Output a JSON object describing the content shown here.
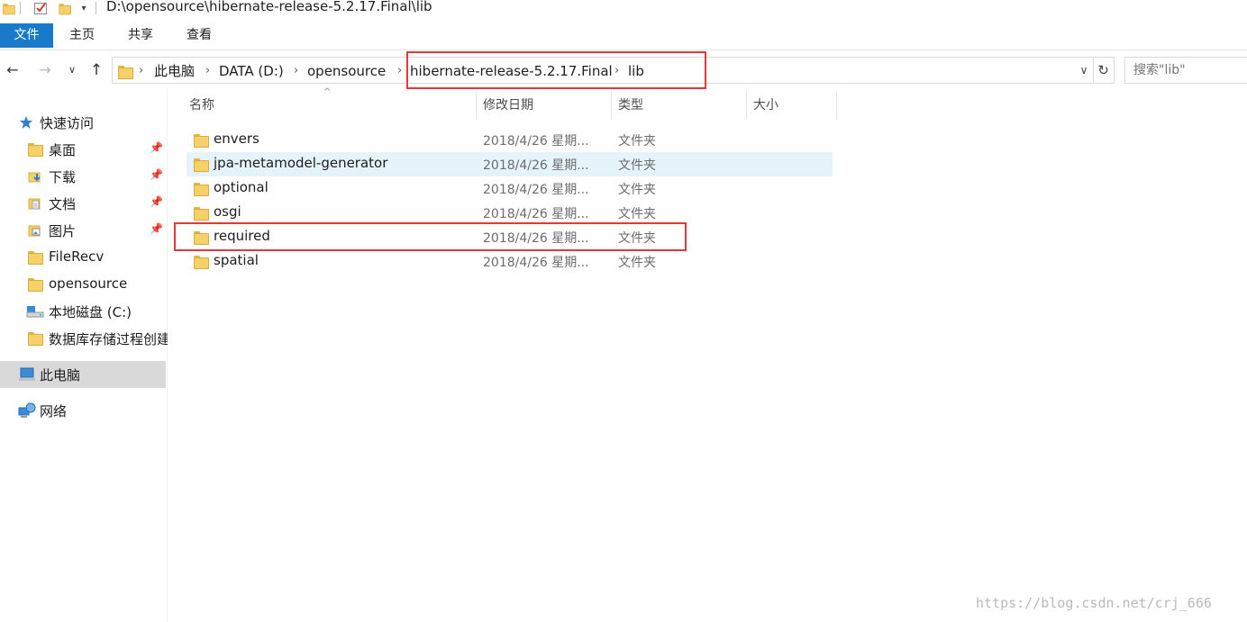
{
  "window": {
    "title": "D:\\opensource\\hibernate-release-5.2.17.Final\\lib"
  },
  "ribbon": {
    "tabs": [
      "文件",
      "主页",
      "共享",
      "查看"
    ]
  },
  "address": {
    "crumbs": [
      "此电脑",
      "DATA (D:)",
      "opensource",
      "hibernate-release-5.2.17.Final",
      "lib"
    ],
    "search_placeholder": "搜索\"lib\""
  },
  "sidebar": {
    "items": [
      {
        "label": "快速访问",
        "icon": "star-icon",
        "pinned": false
      },
      {
        "label": "桌面",
        "icon": "desktop-folder-icon",
        "pinned": true
      },
      {
        "label": "下载",
        "icon": "download-folder-icon",
        "pinned": true
      },
      {
        "label": "文档",
        "icon": "documents-folder-icon",
        "pinned": true
      },
      {
        "label": "图片",
        "icon": "pictures-folder-icon",
        "pinned": true
      },
      {
        "label": "FileRecv",
        "icon": "folder-icon",
        "pinned": false
      },
      {
        "label": "opensource",
        "icon": "folder-icon",
        "pinned": false
      },
      {
        "label": "本地磁盘 (C:)",
        "icon": "drive-icon",
        "pinned": false
      },
      {
        "label": "数据库存储过程创建",
        "icon": "folder-icon",
        "pinned": false
      },
      {
        "label": "此电脑",
        "icon": "computer-icon",
        "pinned": false,
        "selected": true
      },
      {
        "label": "网络",
        "icon": "network-icon",
        "pinned": false
      }
    ]
  },
  "columns": {
    "name": "名称",
    "date": "修改日期",
    "type": "类型",
    "size": "大小"
  },
  "files": [
    {
      "name": "envers",
      "date": "2018/4/26 星期...",
      "type": "文件夹"
    },
    {
      "name": "jpa-metamodel-generator",
      "date": "2018/4/26 星期...",
      "type": "文件夹"
    },
    {
      "name": "optional",
      "date": "2018/4/26 星期...",
      "type": "文件夹"
    },
    {
      "name": "osgi",
      "date": "2018/4/26 星期...",
      "type": "文件夹"
    },
    {
      "name": "required",
      "date": "2018/4/26 星期...",
      "type": "文件夹"
    },
    {
      "name": "spatial",
      "date": "2018/4/26 星期...",
      "type": "文件夹"
    }
  ],
  "watermark": "https://blog.csdn.net/crj_666",
  "colors": {
    "accent": "#1979ca",
    "highlight_red": "#e03a3a",
    "hover_row": "#e5f3fb",
    "selected_nav": "#d9d9d9"
  }
}
